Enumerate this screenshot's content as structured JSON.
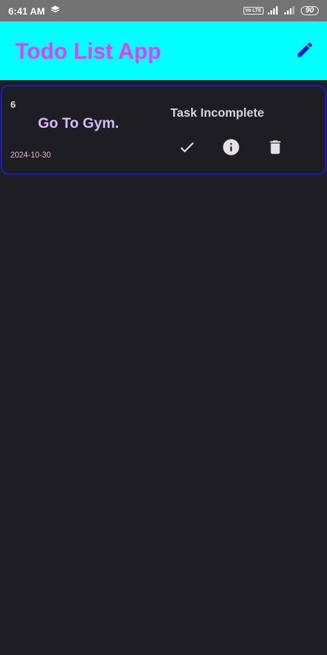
{
  "status_bar": {
    "time": "6:41 AM",
    "volte": "Vo LTE",
    "battery": "90"
  },
  "app_bar": {
    "title": "Todo List App",
    "edit_icon": "pencil-icon"
  },
  "tasks": [
    {
      "id": "6",
      "title": "Go To Gym.",
      "date": "2024-10-30",
      "status": "Task Incomplete",
      "actions": [
        "check-icon",
        "info-icon",
        "delete-icon"
      ]
    }
  ],
  "colors": {
    "status_bar": "#737373",
    "app_bar": "#00ffff",
    "title": "#e040fb",
    "edit_icon": "#1a1ad0",
    "background": "#1f1e22",
    "card_border": "#1a1ad0",
    "task_title": "#d6bafc",
    "task_date": "#e9b7c6"
  }
}
